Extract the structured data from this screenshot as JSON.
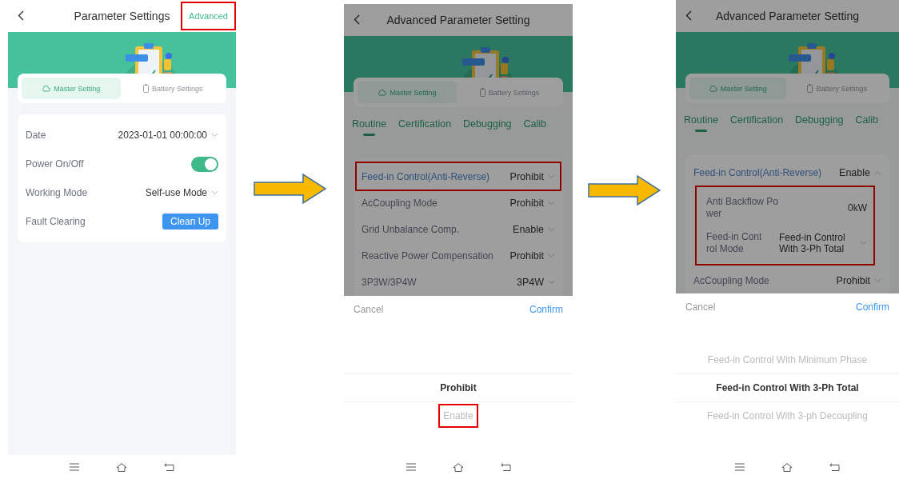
{
  "panels": [
    {
      "kind": "main",
      "title": "Parameter Settings",
      "action": {
        "label": "Advanced",
        "highlighted": true
      },
      "tabs": [
        {
          "label": "Master Setting",
          "selected": true
        },
        {
          "label": "Battery Settings",
          "selected": false
        }
      ],
      "rows": [
        {
          "kind": "select",
          "label": "Date",
          "value": "2023-01-01 00:00:00"
        },
        {
          "kind": "toggle",
          "label": "Power On/Off",
          "on": true
        },
        {
          "kind": "select",
          "label": "Working Mode",
          "value": "Self-use Mode"
        },
        {
          "kind": "button",
          "label": "Fault Clearing",
          "button": "Clean Up"
        }
      ]
    },
    {
      "kind": "advanced",
      "title": "Advanced Parameter Setting",
      "tabs": [
        {
          "label": "Master Setting",
          "selected": true
        },
        {
          "label": "Battery Settings",
          "selected": false
        }
      ],
      "subtabs": [
        {
          "label": "Routine",
          "selected": true
        },
        {
          "label": "Certification",
          "selected": false
        },
        {
          "label": "Debugging",
          "selected": false
        },
        {
          "label": "Calib",
          "selected": false
        }
      ],
      "rows": [
        {
          "label": "Feed-in Control(Anti-Reverse)",
          "value": "Prohibit",
          "active": true,
          "highlighted": true,
          "expanded": false
        },
        {
          "label": "AcCoupling Mode",
          "value": "Prohibit",
          "active": false,
          "highlighted": false,
          "expanded": false
        },
        {
          "label": "Grid Unbalance Comp.",
          "value": "Enable",
          "active": false,
          "highlighted": false,
          "expanded": false
        },
        {
          "label": "Reactive Power Compensation",
          "value": "Prohibit",
          "active": false,
          "highlighted": false,
          "expanded": false
        },
        {
          "label": "3P3W/3P4W",
          "value": "3P4W",
          "active": false,
          "highlighted": false,
          "expanded": false
        }
      ],
      "picker": {
        "cancel": "Cancel",
        "confirm": "Confirm",
        "options": [
          {
            "label": "Prohibit",
            "selected": true,
            "highlighted": false
          },
          {
            "label": "Enable",
            "selected": false,
            "highlighted": true
          }
        ]
      }
    },
    {
      "kind": "advanced",
      "title": "Advanced Parameter Setting",
      "tabs": [
        {
          "label": "Master Setting",
          "selected": true
        },
        {
          "label": "Battery Settings",
          "selected": false
        }
      ],
      "subtabs": [
        {
          "label": "Routine",
          "selected": true
        },
        {
          "label": "Certification",
          "selected": false
        },
        {
          "label": "Debugging",
          "selected": false
        },
        {
          "label": "Calib",
          "selected": false
        }
      ],
      "rows": [
        {
          "label": "Feed-in Control(Anti-Reverse)",
          "value": "Enable",
          "active": true,
          "highlighted": false,
          "expanded": true,
          "children_highlighted": true,
          "children": [
            {
              "label": "Anti Backflow Power",
              "value": "0kW",
              "kind": "text"
            },
            {
              "label": "Feed-in Control Mode",
              "value": "Feed-in Control With 3-Ph Total",
              "kind": "select"
            }
          ]
        },
        {
          "label": "AcCoupling Mode",
          "value": "Prohibit",
          "active": false,
          "highlighted": false,
          "expanded": false
        }
      ],
      "picker": {
        "cancel": "Cancel",
        "confirm": "Confirm",
        "options": [
          {
            "label": "Feed-in Control With Minimum Phase",
            "selected": false,
            "highlighted": false
          },
          {
            "label": "Feed-in Control With 3-Ph Total",
            "selected": true,
            "highlighted": false
          },
          {
            "label": "Feed-in Control With 3-ph Decoupling",
            "selected": false,
            "highlighted": false
          }
        ]
      }
    }
  ]
}
